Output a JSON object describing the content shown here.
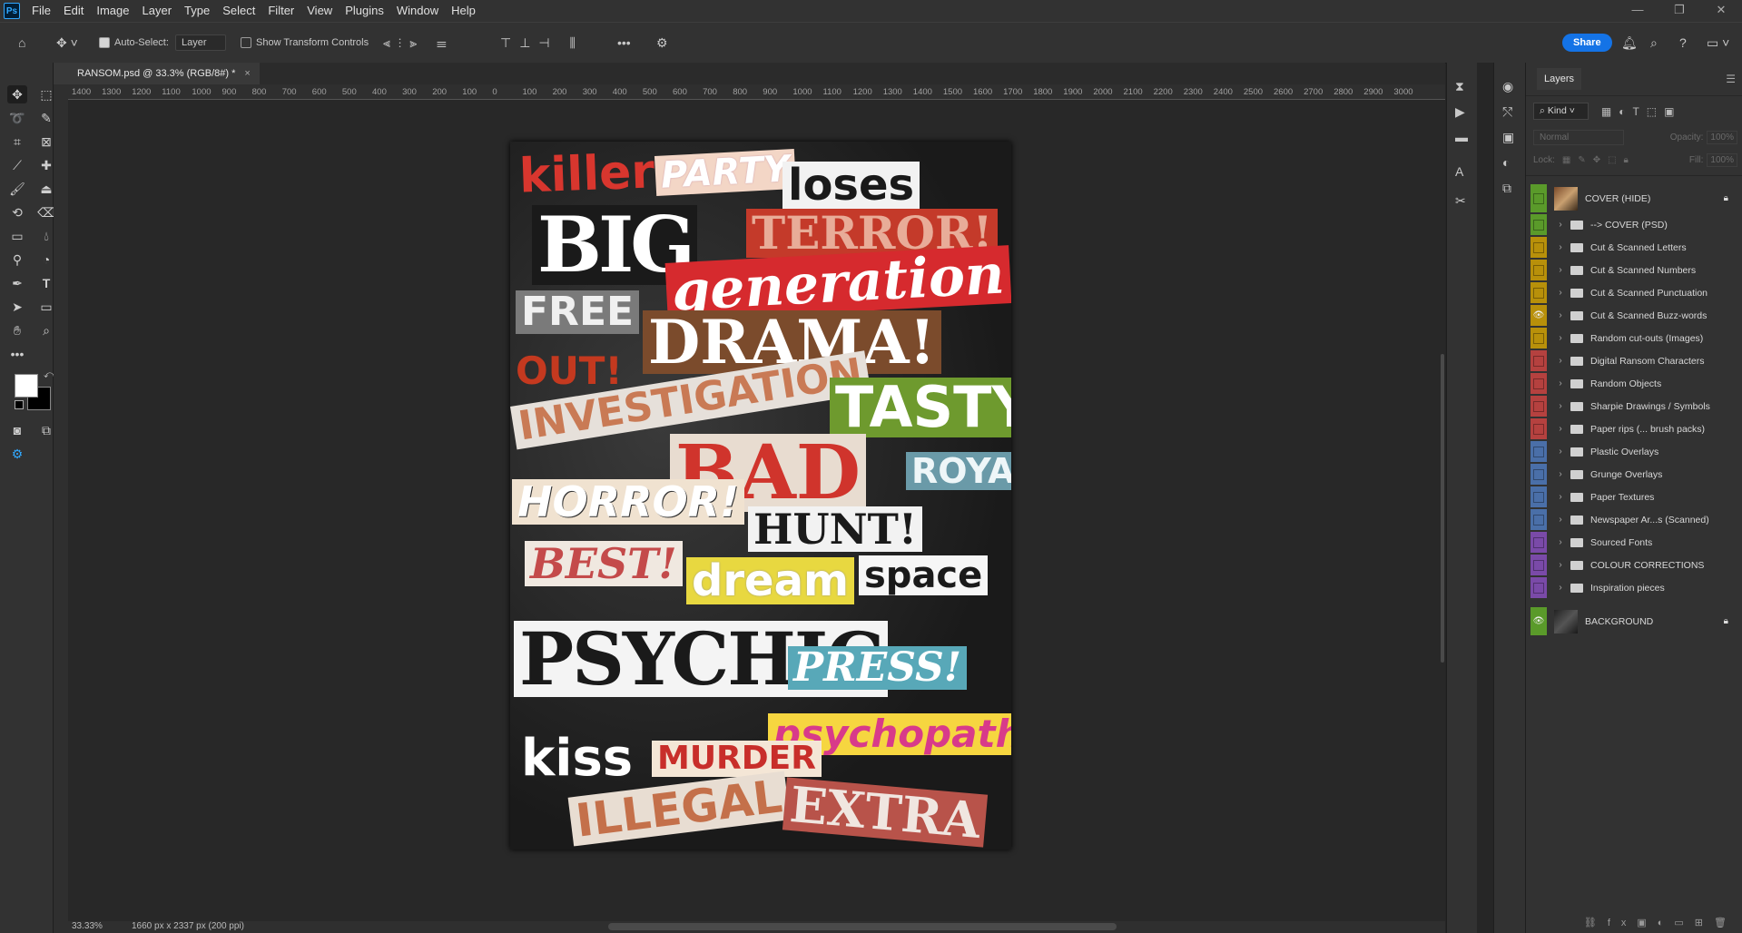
{
  "menu": [
    "File",
    "Edit",
    "Image",
    "Layer",
    "Type",
    "Select",
    "Filter",
    "View",
    "Plugins",
    "Window",
    "Help"
  ],
  "window_controls": {
    "minimize": "—",
    "restore": "❐",
    "close": "✕"
  },
  "options": {
    "auto_select_label": "Auto-Select:",
    "auto_select_value": "Layer",
    "transform_label": "Show Transform Controls",
    "share_label": "Share"
  },
  "document": {
    "tab_title": "RANSOM.psd @ 33.3% (RGB/8#) *",
    "close": "×",
    "zoom": "33.33%",
    "info": "1660 px x 2337 px (200 ppi)"
  },
  "ruler_ticks": [
    "1400",
    "1300",
    "1200",
    "1100",
    "1000",
    "900",
    "800",
    "700",
    "600",
    "500",
    "400",
    "300",
    "200",
    "100",
    "0",
    "100",
    "200",
    "300",
    "400",
    "500",
    "600",
    "700",
    "800",
    "900",
    "1000",
    "1100",
    "1200",
    "1300",
    "1400",
    "1500",
    "1600",
    "1700",
    "1800",
    "1900",
    "2000",
    "2100",
    "2200",
    "2300",
    "2400",
    "2500",
    "2600",
    "2700",
    "2800",
    "2900",
    "3000"
  ],
  "artwork_words": [
    "killer",
    "PARTY",
    "loses",
    "BIG",
    "TERROR!",
    "generation",
    "FREE",
    "DRAMA!",
    "OUT!",
    "INVESTIGATION",
    "TASTY",
    "BAD",
    "ROYAL",
    "HORROR!",
    "HUNT!",
    "BEST!",
    "dream",
    "space",
    "PSYCHIC",
    "PRESS!",
    "psychopath",
    "kiss",
    "MURDER",
    "ILLEGAL",
    "EXTRA"
  ],
  "layers_panel": {
    "title": "Layers",
    "filter_kind": "Kind",
    "blend_mode": "Normal",
    "opacity_label": "Opacity:",
    "opacity_value": "100%",
    "lock_label": "Lock:",
    "fill_label": "Fill:",
    "fill_value": "100%",
    "layers": [
      {
        "name": "COVER (HIDE)",
        "type": "image",
        "color": "#5a9a2a",
        "visible": false,
        "locked": true
      },
      {
        "name": "--> COVER (PSD)",
        "type": "group",
        "color": "#5a9a2a",
        "visible": false,
        "locked": false
      },
      {
        "name": "Cut & Scanned Letters",
        "type": "group",
        "color": "#b8900a",
        "visible": false,
        "locked": false
      },
      {
        "name": "Cut & Scanned Numbers",
        "type": "group",
        "color": "#b8900a",
        "visible": false,
        "locked": false
      },
      {
        "name": "Cut & Scanned Punctuation",
        "type": "group",
        "color": "#b8900a",
        "visible": false,
        "locked": false
      },
      {
        "name": "Cut & Scanned Buzz-words",
        "type": "group",
        "color": "#b8900a",
        "visible": true,
        "locked": false
      },
      {
        "name": "Random cut-outs (Images)",
        "type": "group",
        "color": "#b8900a",
        "visible": false,
        "locked": false
      },
      {
        "name": "Digital Ransom Characters",
        "type": "group",
        "color": "#b5413f",
        "visible": false,
        "locked": false
      },
      {
        "name": "Random Objects",
        "type": "group",
        "color": "#b5413f",
        "visible": false,
        "locked": false
      },
      {
        "name": "Sharpie Drawings / Symbols",
        "type": "group",
        "color": "#b5413f",
        "visible": false,
        "locked": false
      },
      {
        "name": "Paper rips (... brush packs)",
        "type": "group",
        "color": "#b5413f",
        "visible": false,
        "locked": false
      },
      {
        "name": "Plastic Overlays",
        "type": "group",
        "color": "#4a6fa8",
        "visible": false,
        "locked": false
      },
      {
        "name": "Grunge Overlays",
        "type": "group",
        "color": "#4a6fa8",
        "visible": false,
        "locked": false
      },
      {
        "name": "Paper Textures",
        "type": "group",
        "color": "#4a6fa8",
        "visible": false,
        "locked": false
      },
      {
        "name": "Newspaper Ar...s (Scanned)",
        "type": "group",
        "color": "#4a6fa8",
        "visible": false,
        "locked": false
      },
      {
        "name": "Sourced Fonts",
        "type": "group",
        "color": "#7a4aa8",
        "visible": false,
        "locked": false
      },
      {
        "name": "COLOUR CORRECTIONS",
        "type": "group",
        "color": "#7a4aa8",
        "visible": false,
        "locked": false
      },
      {
        "name": "Inspiration pieces",
        "type": "group",
        "color": "#7a4aa8",
        "visible": false,
        "locked": false
      },
      {
        "name": "BACKGROUND",
        "type": "image",
        "color": "#5a9a2a",
        "visible": true,
        "locked": true
      }
    ]
  }
}
